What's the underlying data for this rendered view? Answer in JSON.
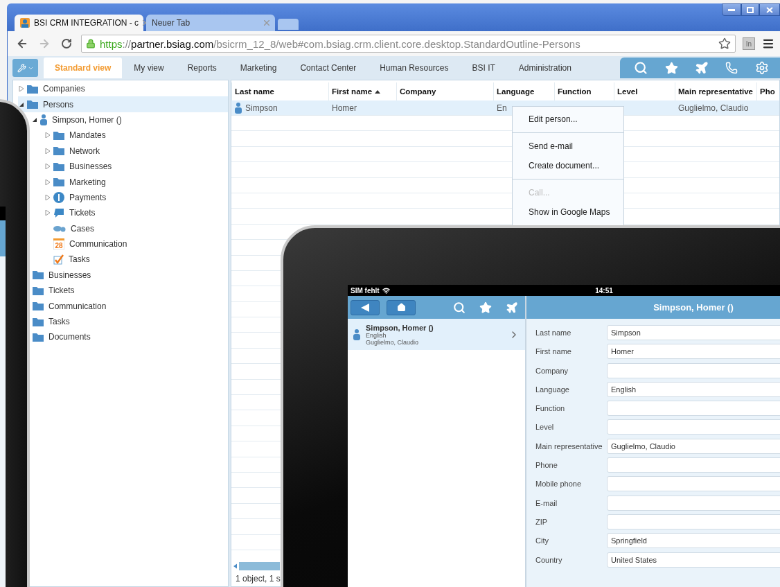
{
  "browser": {
    "tabs": [
      {
        "title": "BSI CRM INTEGRATION - c",
        "selected": true
      },
      {
        "title": "Neuer Tab",
        "selected": false
      }
    ],
    "forward": {
      "disabled": true
    },
    "address": {
      "scheme": "https",
      "separator": "://",
      "host": "partner.bsiag.com",
      "path": "/bsicrm_12_8/web#com.bsiag.crm.client.core.desktop.StandardOutline-Persons"
    },
    "extension_label": "In"
  },
  "views": [
    {
      "label": "Standard view",
      "selected": true
    },
    {
      "label": "My view",
      "selected": false
    },
    {
      "label": "Reports",
      "selected": false
    },
    {
      "label": "Marketing",
      "selected": false
    },
    {
      "label": "Contact Center",
      "selected": false
    },
    {
      "label": "Human Resources",
      "selected": false
    },
    {
      "label": "BSI IT",
      "selected": false
    },
    {
      "label": "Administration",
      "selected": false
    }
  ],
  "tree": [
    {
      "label": "Companies",
      "kind": "folder",
      "expanded": false,
      "selected": false
    },
    {
      "label": "Persons",
      "kind": "folder",
      "expanded": true,
      "selected": true,
      "children": [
        {
          "label": "Simpson, Homer ()",
          "kind": "person",
          "expanded": true,
          "selected": false,
          "children": [
            {
              "label": "Mandates",
              "kind": "folder",
              "expanded": false,
              "selected": false
            },
            {
              "label": "Network",
              "kind": "folder",
              "expanded": false,
              "selected": false
            },
            {
              "label": "Businesses",
              "kind": "folder",
              "expanded": false,
              "selected": false
            },
            {
              "label": "Marketing",
              "kind": "folder",
              "expanded": false,
              "selected": false
            },
            {
              "label": "Payments",
              "kind": "coin",
              "expanded": false,
              "selected": false
            },
            {
              "label": "Tickets",
              "kind": "ticket",
              "expanded": false,
              "selected": false
            },
            {
              "label": "Cases",
              "kind": "tag",
              "selected": false
            },
            {
              "label": "Communication",
              "kind": "calendar",
              "badge": "28",
              "selected": false
            },
            {
              "label": "Tasks",
              "kind": "task",
              "selected": false
            }
          ]
        }
      ]
    },
    {
      "label": "Businesses",
      "kind": "folder",
      "selected": false
    },
    {
      "label": "Tickets",
      "kind": "folder",
      "selected": false
    },
    {
      "label": "Communication",
      "kind": "folder",
      "selected": false
    },
    {
      "label": "Tasks",
      "kind": "folder",
      "selected": false
    },
    {
      "label": "Documents",
      "kind": "folder",
      "selected": false
    }
  ],
  "table": {
    "columns": [
      {
        "label": "Last name"
      },
      {
        "label": "First name",
        "sorted": true
      },
      {
        "label": "Company"
      },
      {
        "label": "Language"
      },
      {
        "label": "Function"
      },
      {
        "label": "Level"
      },
      {
        "label": "Main representative"
      },
      {
        "label": "Pho"
      }
    ],
    "rows": [
      {
        "cells": [
          "Simpson",
          "Homer",
          null,
          "En",
          null,
          null,
          "Guglielmo, Claudio",
          null
        ],
        "selected": true
      }
    ],
    "status": "1 object, 1 s"
  },
  "context_menu": [
    [
      {
        "label": "Edit person...",
        "disabled": false
      }
    ],
    [
      {
        "label": "Send e-mail",
        "disabled": false
      },
      {
        "label": "Create document...",
        "disabled": false
      }
    ],
    [
      {
        "label": "Call...",
        "disabled": true
      },
      {
        "label": "Show in Google Maps",
        "disabled": false
      }
    ]
  ],
  "tablet": {
    "status": {
      "carrier": "SIM fehlt",
      "time": "14:51"
    },
    "list": [
      {
        "title": "Simpson, Homer ()",
        "lines": [
          "English",
          "Guglielmo, Claudio"
        ],
        "selected": true
      }
    ],
    "detail_title": "Simpson, Homer ()",
    "fields": [
      {
        "label": "Last name",
        "value": "Simpson"
      },
      {
        "label": "First name",
        "value": "Homer"
      },
      {
        "label": "Company"
      },
      {
        "label": "Language",
        "value": "English"
      },
      {
        "label": "Function"
      },
      {
        "label": "Level"
      },
      {
        "label": "Main representative",
        "value": "Guglielmo, Claudio"
      },
      {
        "label": "Phone"
      },
      {
        "label": "Mobile phone"
      },
      {
        "label": "E-mail"
      },
      {
        "label": "ZIP"
      },
      {
        "label": "City",
        "value": "Springfield"
      },
      {
        "label": "Country",
        "value": "United States"
      }
    ]
  }
}
